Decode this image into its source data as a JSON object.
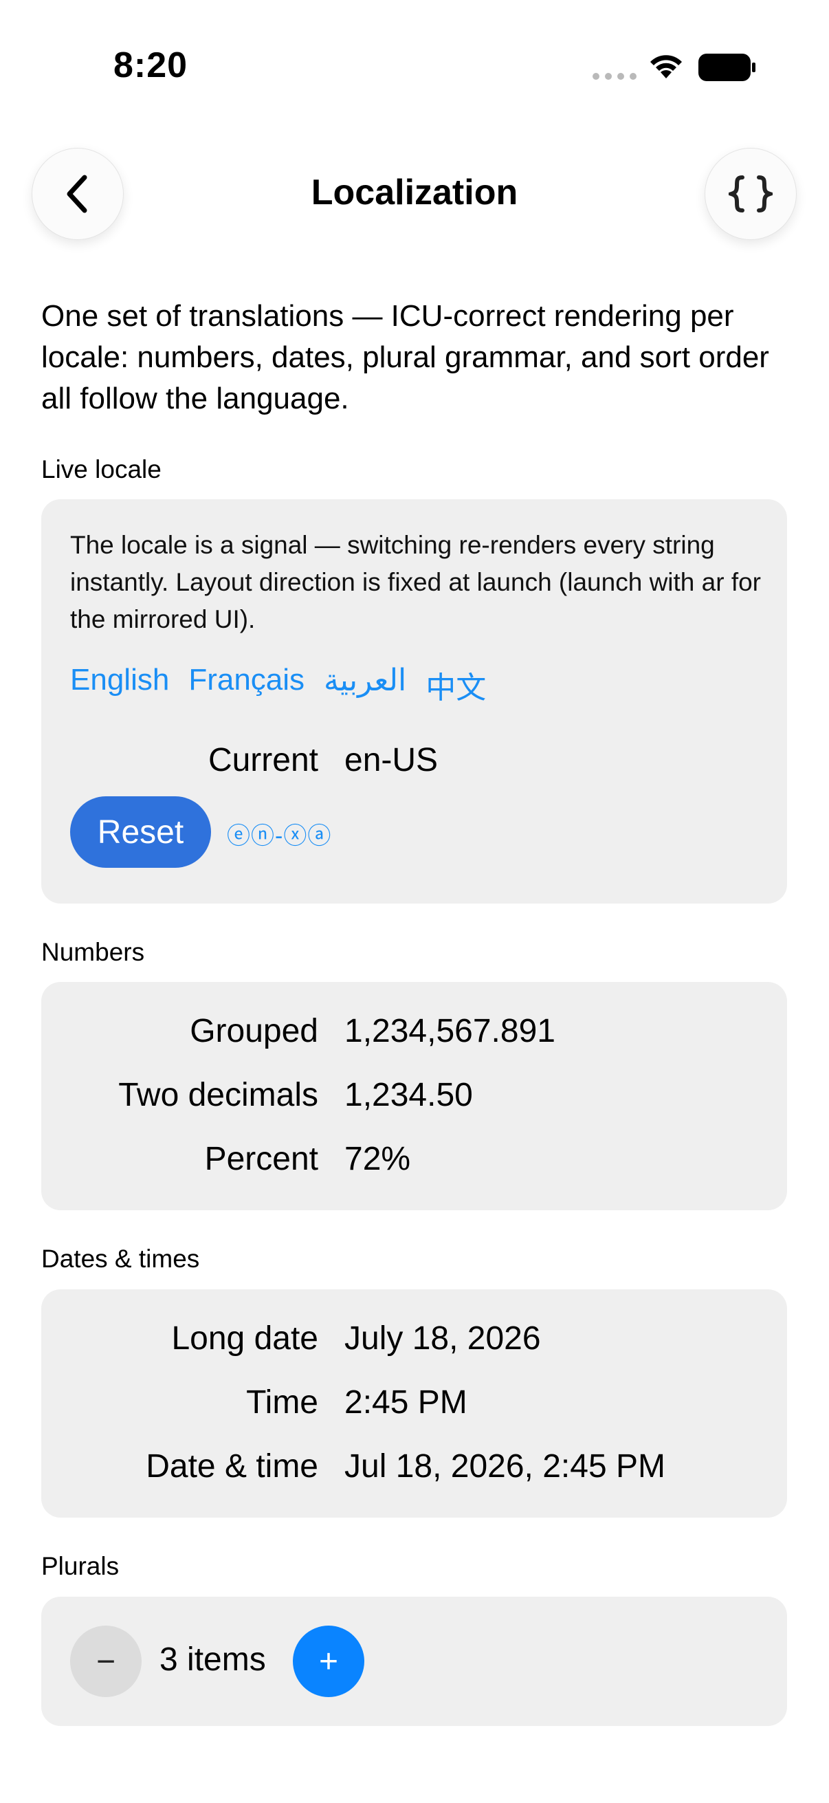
{
  "status": {
    "time": "8:20"
  },
  "nav": {
    "title": "Localization",
    "back_icon": "chevron-left-icon",
    "code_icon": "braces-icon"
  },
  "intro": "One set of translations — ICU-correct rendering per locale: numbers, dates, plural grammar, and sort order all follow the language.",
  "live_locale": {
    "label": "Live locale",
    "note": "The locale is a signal — switching re-renders every string instantly. Layout direction is fixed at launch (launch with ar for the mirrored UI).",
    "languages": [
      "English",
      "Français",
      "العربية",
      "中文"
    ],
    "current_label": "Current",
    "current_value": "en-US",
    "reset_label": "Reset",
    "pseudo_locale": "ⓔⓝ-ⓧⓐ"
  },
  "numbers": {
    "label": "Numbers",
    "rows": [
      {
        "key": "Grouped",
        "value": "1,234,567.891"
      },
      {
        "key": "Two decimals",
        "value": "1,234.50"
      },
      {
        "key": "Percent",
        "value": "72%"
      }
    ]
  },
  "dates": {
    "label": "Dates & times",
    "rows": [
      {
        "key": "Long date",
        "value": "July 18, 2026"
      },
      {
        "key": "Time",
        "value": "2:45 PM"
      },
      {
        "key": "Date & time",
        "value": "Jul 18, 2026, 2:45 PM"
      }
    ]
  },
  "plurals": {
    "label": "Plurals",
    "minus": "−",
    "count_text": "3 items",
    "plus": "+"
  }
}
